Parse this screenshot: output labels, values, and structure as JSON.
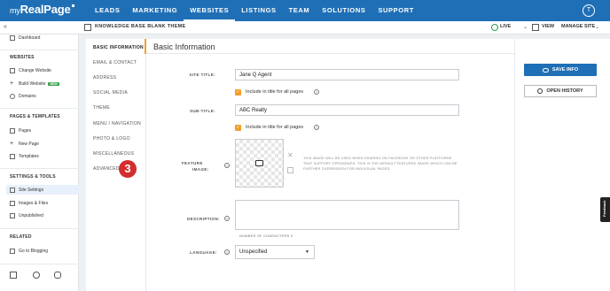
{
  "topnav": {
    "logo_my": "my",
    "logo_main": "RealPage",
    "links": [
      "LEADS",
      "MARKETING",
      "WEBSITES",
      "LISTINGS",
      "TEAM",
      "SOLUTIONS",
      "SUPPORT"
    ],
    "active": "WEBSITES",
    "avatar_initial": "T"
  },
  "subbar": {
    "theme": "KNOWLEDGE BASE BLANK THEME",
    "live": "LIVE",
    "view": "VIEW",
    "manage": "MANAGE SITE"
  },
  "sidebar": {
    "dashboard": "Dashboard",
    "websites_section": "WEBSITES",
    "change_website": "Change Website",
    "build_website": "Build Website",
    "new_badge": "NEW",
    "domains": "Domains",
    "pages_section": "PAGES & TEMPLATES",
    "pages": "Pages",
    "new_page": "New Page",
    "templates": "Templates",
    "settings_section": "SETTINGS & TOOLS",
    "site_settings": "Site Settings",
    "images_files": "Images & Files",
    "unpublished": "Unpublished",
    "related_section": "RELATED",
    "go_to_blogging": "Go to Blogging"
  },
  "tabs": [
    "BASIC INFORMATION",
    "EMAIL & CONTACT",
    "ADDRESS",
    "SOCIAL MEDIA",
    "THEME",
    "MENU / NAVIGATION",
    "PHOTO & LOGO",
    "MISCELLANEOUS",
    "ADVANCED"
  ],
  "active_tab": "BASIC INFORMATION",
  "step_badge": "3",
  "content": {
    "title": "Basic Information",
    "site_title_label": "SITE TITLE:",
    "site_title_value": "Jane Q Agent",
    "include_title_1": "Include in title for all pages",
    "sub_title_label": "SUB-TITLE:",
    "sub_title_value": "ABC Realty",
    "include_title_2": "Include in title for all pages",
    "feature_image_label_1": "FEATURE",
    "feature_image_label_2": "IMAGE:",
    "feature_image_note": "THIS IMAGE WILL BE USED WHEN SHARING ON FACEBOOK OR OTHER PLATFORMS THAT SUPPORT OPENGRAPH. THIS IS THE DEFAULT FEATURED IMAGE WHICH CAN BE FURTHER OVERRIDDEN FOR INDIVIDUAL PAGES.",
    "description_label": "DESCRIPTION:",
    "char_count": "NUMBER OF CHARACTERS 0",
    "language_label": "LANGUAGE:",
    "language_value": "Unspecified"
  },
  "actions": {
    "save": "SAVE INFO",
    "history": "OPEN HISTORY"
  },
  "feedback": "Feedback",
  "colors": {
    "nav_blue": "#1f6fb6",
    "accent_orange": "#f0a02b",
    "badge_red": "#d32d2d",
    "new_green": "#3aa14c"
  }
}
